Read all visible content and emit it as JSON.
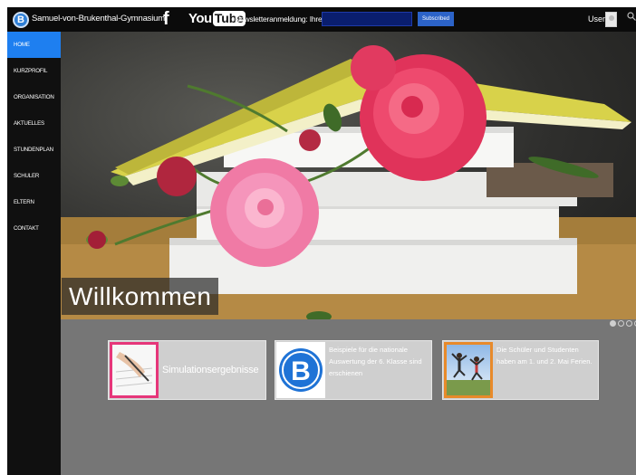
{
  "topbar": {
    "logo_letter": "B",
    "site_title": "Samuel-von-Brukenthal-Gymnasium",
    "facebook_glyph": "f",
    "youtube_you": "You",
    "youtube_tube": "Tube",
    "newsletter_label": "Newsletteranmeldung: Ihre Email *",
    "newsletter_value": "",
    "subscribe_label": "Subscribed",
    "user_label": "User"
  },
  "sidebar": {
    "items": [
      {
        "label": "HOME",
        "active": true
      },
      {
        "label": "KURZPROFIL"
      },
      {
        "label": "ORGANISATION"
      },
      {
        "label": "AKTUELLES"
      },
      {
        "label": "STUNDENPLAN"
      },
      {
        "label": "SCHULER"
      },
      {
        "label": "ELTERN"
      },
      {
        "label": "CONTAKT"
      }
    ]
  },
  "hero": {
    "welcome": "Willkommen",
    "slides_total": 4,
    "slide_active": 1
  },
  "cards": [
    {
      "title": "Simulationsergebnisse"
    },
    {
      "logo_letter": "B",
      "text": "Beispiele für die nationale Auswertung der 6. Klasse sind erschienen"
    },
    {
      "text": "Die Schüler und Studenten haben am 1. und 2. Mai Ferien."
    }
  ],
  "colors": {
    "accent": "#1e7ff0",
    "topbar": "#0b0b0b",
    "sidebar": "#101010",
    "lower_bg": "#767676",
    "card_pink": "#e6367a",
    "card_orange": "#e88a2a"
  }
}
